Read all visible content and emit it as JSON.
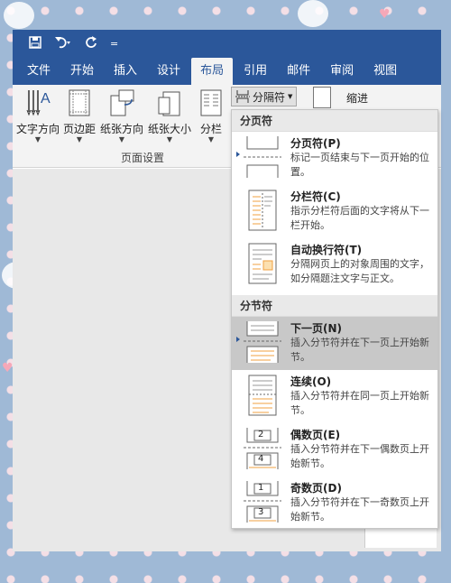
{
  "qat": {
    "save_icon": "save-icon",
    "undo_icon": "undo-icon",
    "redo_icon": "redo-icon",
    "customize": "="
  },
  "tabs": [
    {
      "label": "文件"
    },
    {
      "label": "开始"
    },
    {
      "label": "插入"
    },
    {
      "label": "设计"
    },
    {
      "label": "布局"
    },
    {
      "label": "引用"
    },
    {
      "label": "邮件"
    },
    {
      "label": "审阅"
    },
    {
      "label": "视图"
    }
  ],
  "ribbon": {
    "text_direction": "文字方向",
    "margins": "页边距",
    "orientation": "纸张方向",
    "size": "纸张大小",
    "columns": "分栏",
    "breaks": "分隔符",
    "indent": "缩进",
    "group_label": "页面设置"
  },
  "breaks_menu": {
    "page_section": "分页符",
    "section_section": "分节符",
    "items": [
      {
        "title": "分页符(P)",
        "desc": "标记一页结束与下一页开始的位置。"
      },
      {
        "title": "分栏符(C)",
        "desc": "指示分栏符后面的文字将从下一栏开始。"
      },
      {
        "title": "自动换行符(T)",
        "desc": "分隔网页上的对象周围的文字，如分隔题注文字与正文。"
      },
      {
        "title": "下一页(N)",
        "desc": "插入分节符并在下一页上开始新节。"
      },
      {
        "title": "连续(O)",
        "desc": "插入分节符并在同一页上开始新节。"
      },
      {
        "title": "偶数页(E)",
        "desc": "插入分节符并在下一偶数页上开始新节。"
      },
      {
        "title": "奇数页(D)",
        "desc": "插入分节符并在下一奇数页上开始新节。"
      }
    ],
    "even_num1": "2",
    "even_num2": "4",
    "odd_num1": "1",
    "odd_num2": "3"
  },
  "colors": {
    "brand": "#2b579a",
    "selected": "#c8c8c8"
  }
}
